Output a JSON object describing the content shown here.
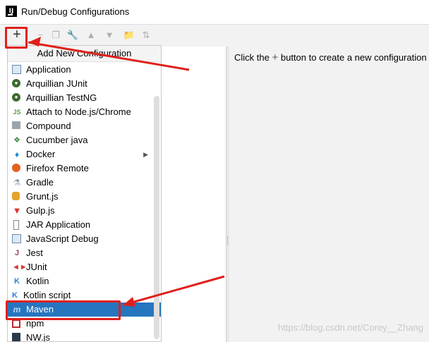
{
  "window": {
    "title": "Run/Debug Configurations",
    "app_icon": "IJ"
  },
  "toolbar": {
    "add_label": "+",
    "icons": [
      "remove-icon",
      "copy-icon",
      "wrench-icon",
      "move-up-icon",
      "move-down-icon",
      "folder-icon",
      "sort-icon"
    ]
  },
  "popup": {
    "header": "Add New Configuration",
    "items": [
      {
        "label": "Application",
        "icon": "application-icon"
      },
      {
        "label": "Arquillian JUnit",
        "icon": "arquillian-icon"
      },
      {
        "label": "Arquillian TestNG",
        "icon": "arquillian-icon"
      },
      {
        "label": "Attach to Node.js/Chrome",
        "icon": "nodejs-icon"
      },
      {
        "label": "Compound",
        "icon": "compound-icon"
      },
      {
        "label": "Cucumber java",
        "icon": "cucumber-icon"
      },
      {
        "label": "Docker",
        "icon": "docker-icon",
        "submenu": true
      },
      {
        "label": "Firefox Remote",
        "icon": "firefox-icon"
      },
      {
        "label": "Gradle",
        "icon": "gradle-icon"
      },
      {
        "label": "Grunt.js",
        "icon": "grunt-icon"
      },
      {
        "label": "Gulp.js",
        "icon": "gulp-icon"
      },
      {
        "label": "JAR Application",
        "icon": "jar-icon"
      },
      {
        "label": "JavaScript Debug",
        "icon": "js-debug-icon"
      },
      {
        "label": "Jest",
        "icon": "jest-icon"
      },
      {
        "label": "JUnit",
        "icon": "junit-icon"
      },
      {
        "label": "Kotlin",
        "icon": "kotlin-icon"
      },
      {
        "label": "Kotlin script",
        "icon": "kotlin-icon"
      },
      {
        "label": "Maven",
        "icon": "maven-icon",
        "selected": true
      },
      {
        "label": "npm",
        "icon": "npm-icon"
      },
      {
        "label": "NW.js",
        "icon": "nwjs-icon"
      }
    ]
  },
  "right_pane": {
    "hint_before": "Click the",
    "hint_plus": "+",
    "hint_after": "button to create a new configuration"
  },
  "watermark": "https://blog.csdn.net/Corey__Zhang",
  "colors": {
    "selection": "#2675bf",
    "annotation_red": "#e0201b"
  }
}
